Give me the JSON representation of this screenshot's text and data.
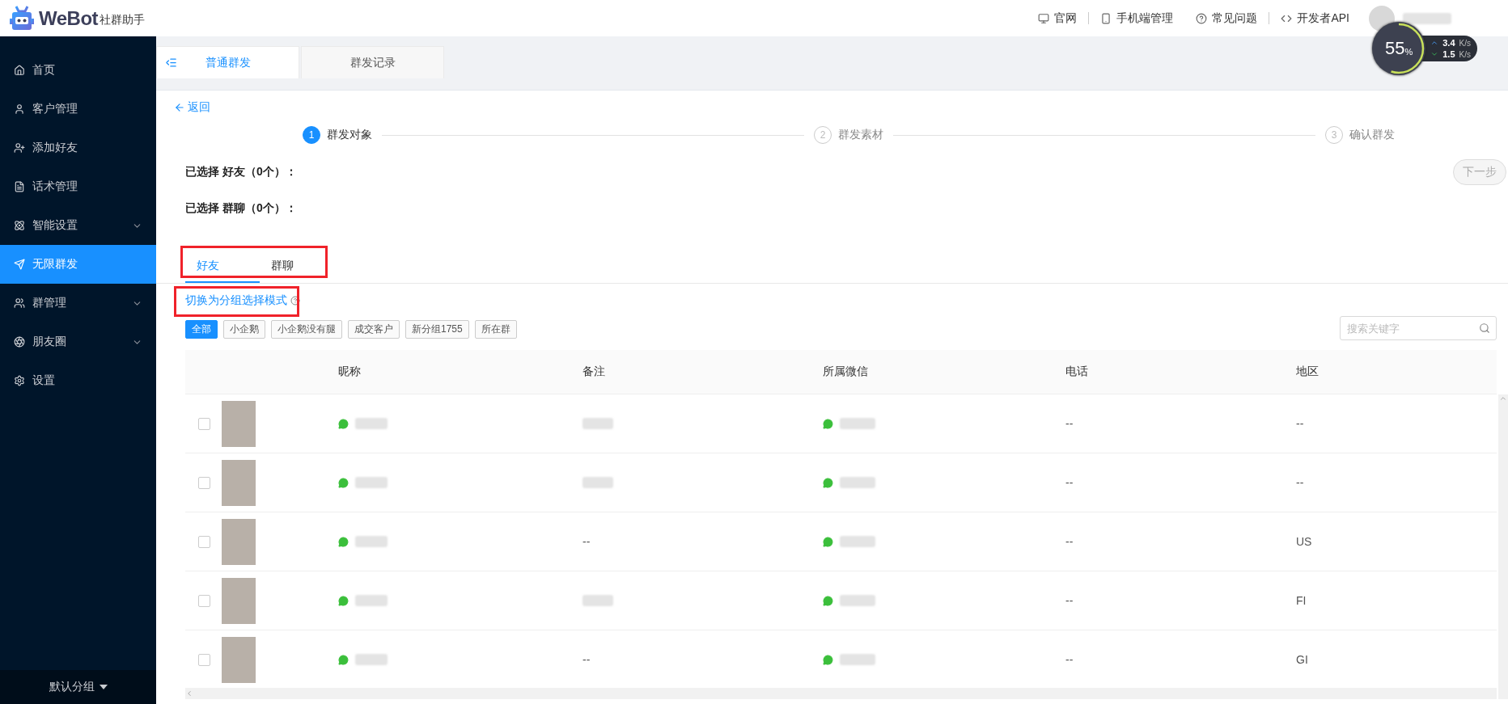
{
  "brand": {
    "name": "WeBot",
    "tagline": "社群助手"
  },
  "top_links": [
    "官网",
    "手机端管理",
    "常见问题",
    "开发者API"
  ],
  "speed_widget": {
    "percent": "55",
    "unit": "%",
    "upload": "3.4",
    "upload_unit": "K/s",
    "download": "1.5",
    "download_unit": "K/s"
  },
  "sidebar": {
    "items": [
      {
        "label": "首页",
        "expandable": false,
        "selected": false
      },
      {
        "label": "客户管理",
        "expandable": false,
        "selected": false
      },
      {
        "label": "添加好友",
        "expandable": false,
        "selected": false
      },
      {
        "label": "话术管理",
        "expandable": false,
        "selected": false
      },
      {
        "label": "智能设置",
        "expandable": true,
        "selected": false
      },
      {
        "label": "无限群发",
        "expandable": false,
        "selected": true
      },
      {
        "label": "群管理",
        "expandable": true,
        "selected": false
      },
      {
        "label": "朋友圈",
        "expandable": true,
        "selected": false
      },
      {
        "label": "设置",
        "expandable": false,
        "selected": false
      }
    ],
    "footer": "默认分组"
  },
  "page_tabs": [
    {
      "label": "普通群发",
      "selected": true
    },
    {
      "label": "群发记录",
      "selected": false
    }
  ],
  "back_link": "返回",
  "steps": [
    {
      "number": "1",
      "label": "群发对象",
      "active": true
    },
    {
      "number": "2",
      "label": "群发素材",
      "active": false
    },
    {
      "number": "3",
      "label": "确认群发",
      "active": false
    }
  ],
  "next_button": {
    "label": "下一步",
    "disabled": true
  },
  "selected_summary": [
    "已选择 好友（0个）：",
    "已选择 群聊（0个）："
  ],
  "target_tabs": [
    {
      "label": "好友",
      "selected": true
    },
    {
      "label": "群聊",
      "selected": false
    }
  ],
  "mode_link": "切换为分组选择模式",
  "group_tags": [
    {
      "label": "全部",
      "selected": true
    },
    {
      "label": "小企鹅",
      "selected": false
    },
    {
      "label": "小企鹅没有腿",
      "selected": false
    },
    {
      "label": "成交客户",
      "selected": false
    },
    {
      "label": "新分组1755",
      "selected": false
    },
    {
      "label": "所在群",
      "selected": false
    }
  ],
  "search": {
    "placeholder": "搜索关键字"
  },
  "table": {
    "columns": [
      "昵称",
      "备注",
      "所属微信",
      "电话",
      "地区"
    ],
    "rows": [
      {
        "checked": false,
        "phone": "--",
        "region": "--"
      },
      {
        "checked": false,
        "phone": "--",
        "region": "--"
      },
      {
        "checked": false,
        "remark": "--",
        "phone": "--",
        "region": "US"
      },
      {
        "checked": false,
        "phone": "--",
        "region": "FI"
      },
      {
        "checked": false,
        "remark": "--",
        "phone": "--",
        "region": "GI"
      }
    ]
  }
}
